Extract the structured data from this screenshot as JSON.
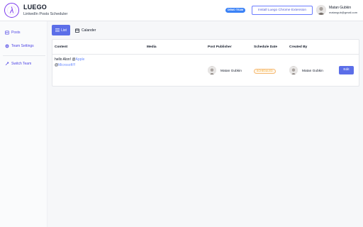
{
  "header": {
    "app_title": "LUEGO",
    "app_subtitle": "LinkedIn Posts Scheduler",
    "demo_badge": "DEMO TEAM",
    "install_button": "Install Luego Chrome Extension",
    "user_name": "Matan Gubkin",
    "user_email": "matangub@gmail.com"
  },
  "sidebar": {
    "items": [
      {
        "label": "Posts",
        "icon": "posts-icon"
      },
      {
        "label": "Team Settings",
        "icon": "gear-icon"
      },
      {
        "label": "Switch Team",
        "icon": "switch-icon"
      }
    ]
  },
  "view_tabs": {
    "list": "List",
    "calendar": "Calander"
  },
  "table": {
    "columns": [
      "Content",
      "Media",
      "Post Publisher",
      "Schedule Date",
      "Created By"
    ],
    "rows": [
      {
        "content_text": "hello Alon! @",
        "mention_1": "Apple",
        "content_at": "@",
        "mention_2": "Microsoft!!!",
        "media": "",
        "publisher": "Matan Gubkin",
        "status": "SCHEDULED",
        "created_by": "Matan Gubkin",
        "action": "Edit"
      }
    ]
  },
  "colors": {
    "accent": "#5b6ee8",
    "brand": "#7c3aed",
    "status_scheduled": "#f59e0b"
  }
}
